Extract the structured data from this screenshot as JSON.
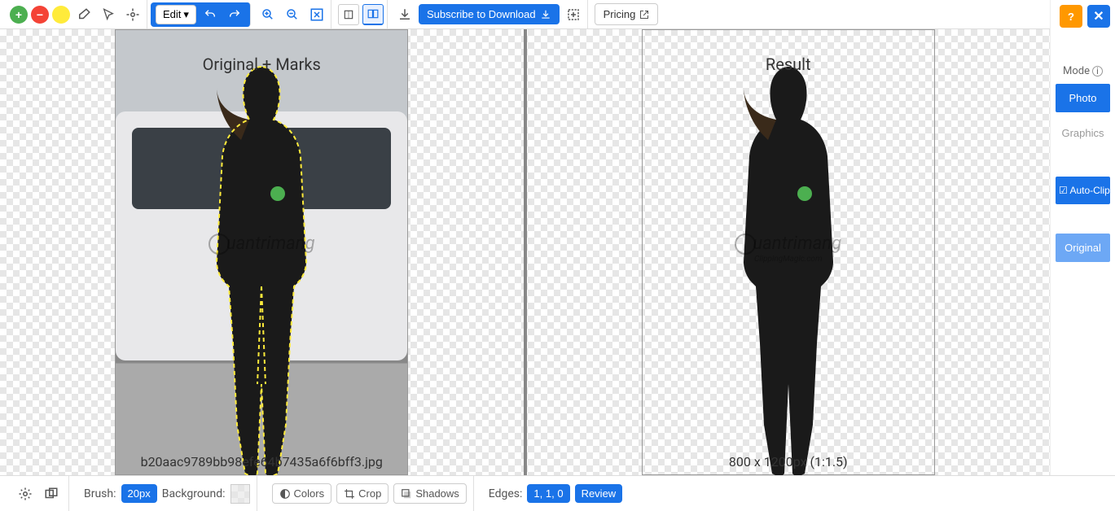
{
  "toolbar": {
    "edit_label": "Edit",
    "subscribe_label": "Subscribe to Download",
    "pricing_label": "Pricing"
  },
  "panes": {
    "left_label": "Original + Marks",
    "right_label": "Result",
    "filename": "b20aac9789bb98efe64b7435a6f6bff3.jpg",
    "dimensions": "800 x 1200px (1:1.5)",
    "watermark": "uantrimang"
  },
  "sidebar": {
    "mode_label": "Mode",
    "photo_label": "Photo",
    "graphics_label": "Graphics",
    "autoclip_label": "Auto-Clip",
    "original_label": "Original"
  },
  "bottom": {
    "brush_label": "Brush:",
    "brush_value": "20px",
    "background_label": "Background:",
    "colors_label": "Colors",
    "crop_label": "Crop",
    "shadows_label": "Shadows",
    "edges_label": "Edges:",
    "edges_value": "1, 1, 0",
    "review_label": "Review"
  }
}
